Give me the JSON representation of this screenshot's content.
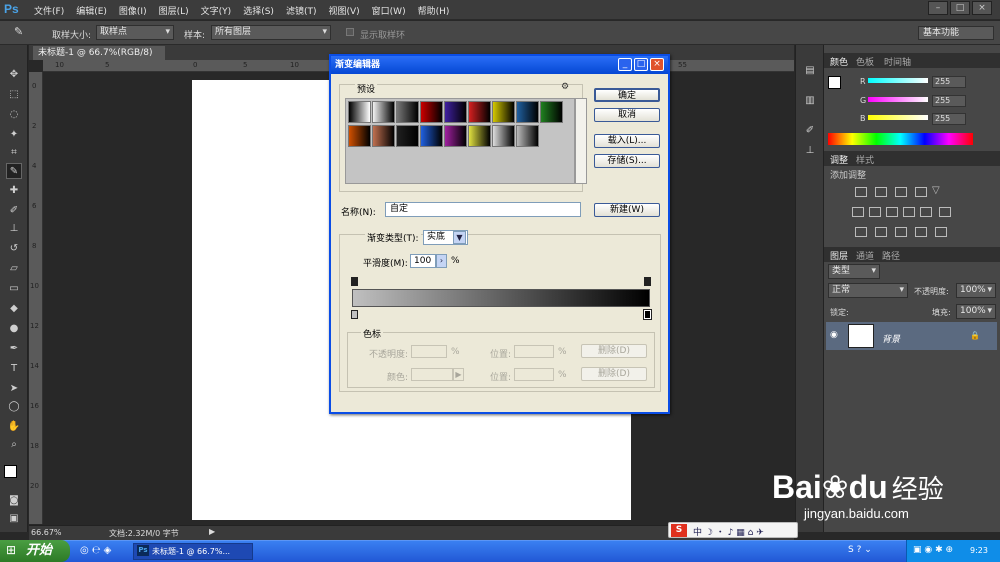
{
  "app": {
    "logo": "Ps",
    "menus": [
      "文件(F)",
      "编辑(E)",
      "图像(I)",
      "图层(L)",
      "文字(Y)",
      "选择(S)",
      "滤镜(T)",
      "视图(V)",
      "窗口(W)",
      "帮助(H)"
    ],
    "window_buttons": [
      "–",
      "□",
      "×"
    ]
  },
  "options_bar": {
    "sample_size_label": "取样大小:",
    "sample_size_value": "取样点",
    "sample_label": "样本:",
    "sample_value": "所有图层",
    "show_ring_label": "显示取样环",
    "workspace": "基本功能"
  },
  "document": {
    "tab_title": "未标题-1 @ 66.7%(RGB/8)",
    "tab_close": "×",
    "ruler_top_ticks": [
      "10",
      "5",
      "0",
      "5",
      "10",
      "15",
      "20",
      "25",
      "30",
      "35",
      "40",
      "45",
      "50",
      "55"
    ],
    "ruler_left_ticks": [
      "0",
      "2",
      "4",
      "6",
      "8",
      "10",
      "12",
      "14",
      "16",
      "18",
      "20"
    ],
    "zoom": "66.67%",
    "doc_info": "文档:2.32M/0 字节"
  },
  "panels": {
    "color_tabs": [
      "颜色",
      "色板",
      "时间轴"
    ],
    "channels": [
      {
        "label": "R",
        "value": "255",
        "color": "#e03030"
      },
      {
        "label": "G",
        "value": "255",
        "color": "#d040d0"
      },
      {
        "label": "B",
        "value": "255",
        "color": "#e0e020"
      }
    ],
    "adjust_tabs": [
      "调整",
      "样式"
    ],
    "adjust_title": "添加调整",
    "layers_tabs": [
      "图层",
      "通道",
      "路径"
    ],
    "kind_label": "类型",
    "blend_mode": "正常",
    "opacity_label": "不透明度:",
    "opacity_value": "100%",
    "lock_label": "锁定:",
    "fill_label": "填充:",
    "fill_value": "100%",
    "layer_name": "背景"
  },
  "dialog": {
    "title": "渐变编辑器",
    "presets_label": "预设",
    "buttons": {
      "ok": "确定",
      "cancel": "取消",
      "load": "载入(L)...",
      "save": "存储(S)...",
      "new": "新建(W)"
    },
    "name_label": "名称(N):",
    "name_value": "自定",
    "gradient_type_label": "渐变类型(T):",
    "gradient_type_value": "实底",
    "smoothness_label": "平滑度(M):",
    "smoothness_value": "100",
    "percent": "%",
    "stops_group_label": "色标",
    "opacity_label": "不透明度:",
    "color_label": "颜色:",
    "location_label": "位置:",
    "delete_label": "删除(D)",
    "swatch_colors": [
      [
        "#000000",
        "#f2f2f2",
        "#777777",
        "#cc0000",
        "#4020a0",
        "#d42020",
        "#d4c800",
        "#2060a0",
        "#208020"
      ],
      [
        "#d05000",
        "#c07050",
        "#202020",
        "#2060e0",
        "#a020a0",
        "#e0e040",
        "#dddddd",
        "#bbbbbb"
      ]
    ]
  },
  "taskbar": {
    "start": "开始",
    "task_item": "未标题-1 @ 66.7%...",
    "clock": "9:23"
  },
  "watermark": {
    "brand": "Bai",
    "brand2": "du",
    "suffix": "经验",
    "url": "jingyan.baidu.com"
  }
}
